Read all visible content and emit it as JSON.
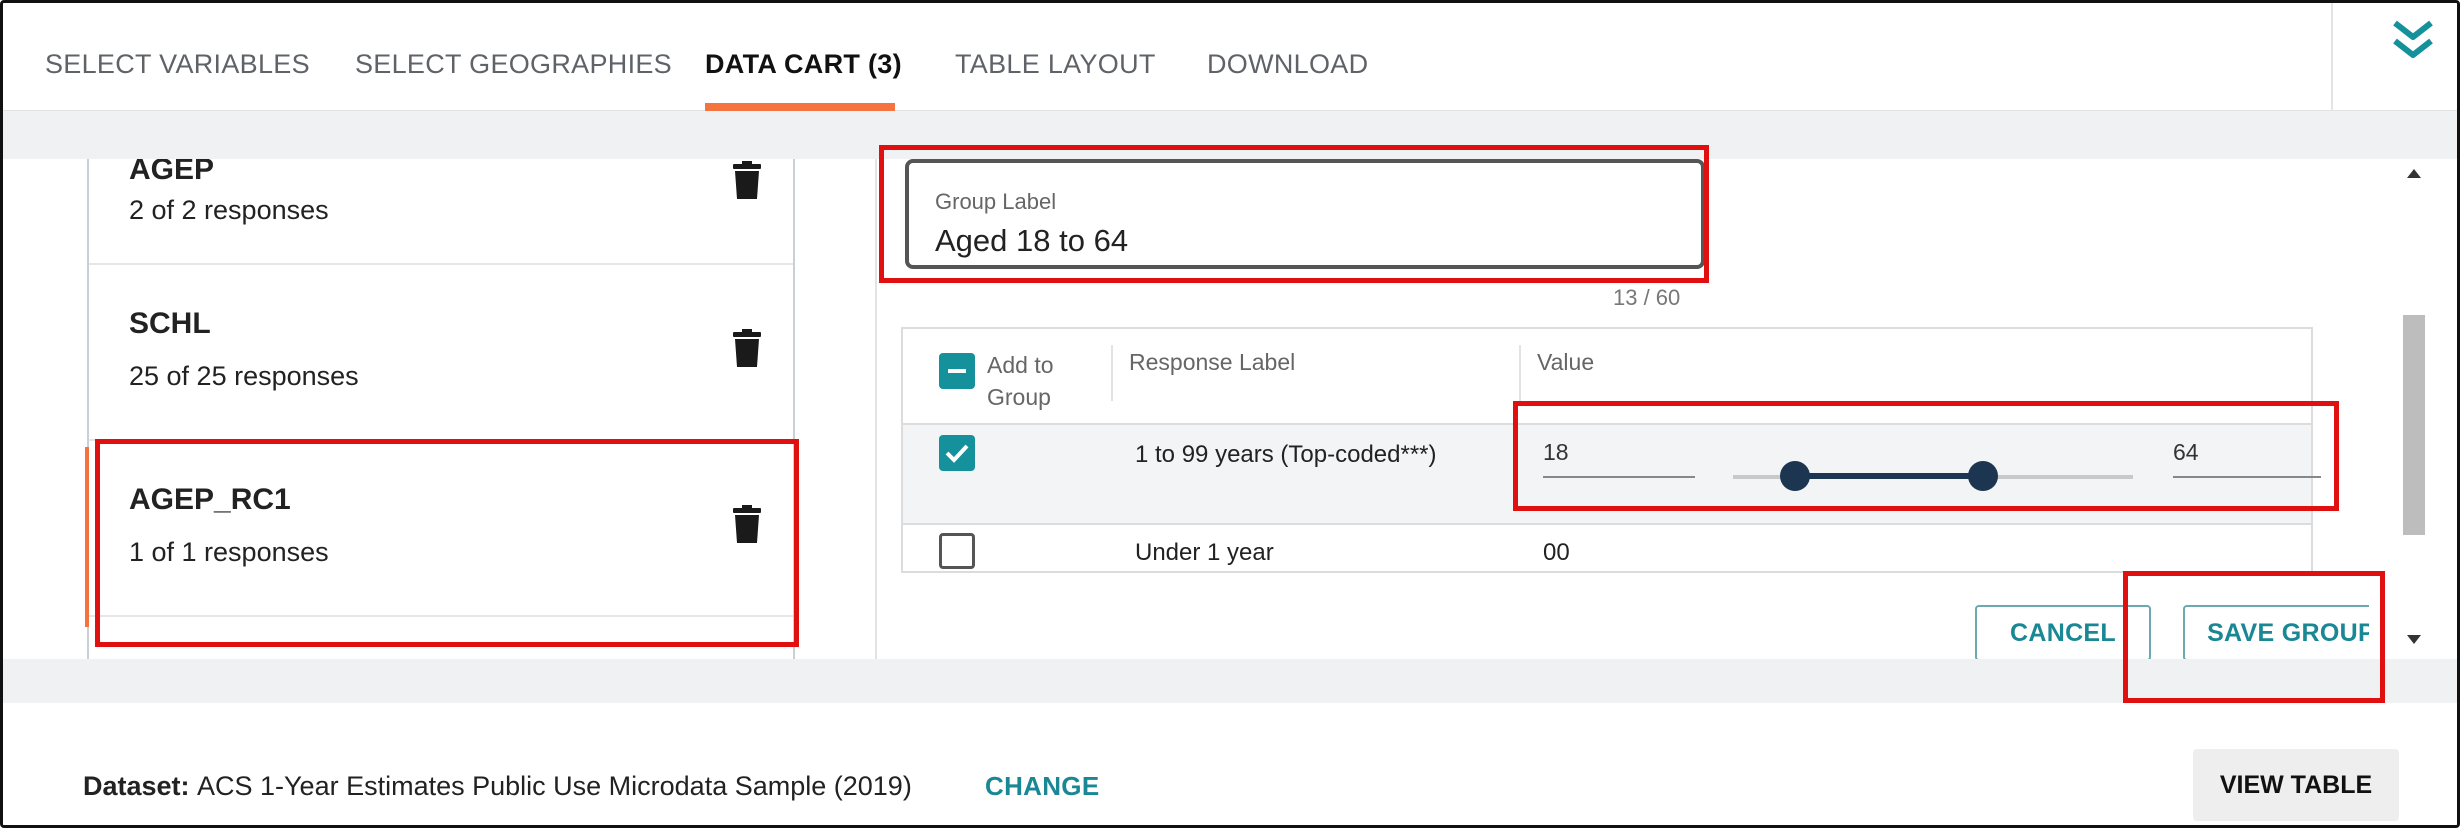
{
  "nav": {
    "tabs": [
      {
        "label": "SELECT VARIABLES"
      },
      {
        "label": "SELECT GEOGRAPHIES"
      },
      {
        "label": "DATA CART (3)"
      },
      {
        "label": "TABLE LAYOUT"
      },
      {
        "label": "DOWNLOAD"
      }
    ],
    "active_tab": "DATA CART (3)",
    "collapse_icon": "double-chevron-down-icon"
  },
  "cart": {
    "items": [
      {
        "name": "AGEP",
        "count": "2 of 2 responses"
      },
      {
        "name": "SCHL",
        "count": "25 of 25 responses"
      },
      {
        "name": "AGEP_RC1",
        "count": "1 of 1 responses"
      }
    ]
  },
  "group_editor": {
    "label_caption": "Group Label",
    "label_value": "Aged 18 to 64",
    "char_count": "13 / 60",
    "table": {
      "headers": {
        "add": "Add to Group",
        "response_label": "Response Label",
        "value": "Value"
      },
      "rows": [
        {
          "checked": true,
          "label": "1 to 99 years (Top-coded***)",
          "value_min": "18",
          "value_max": "64",
          "range_lower_fraction": 0.2,
          "range_upper_fraction": 0.65
        },
        {
          "checked": false,
          "label": "Under 1 year",
          "value": "00"
        }
      ]
    },
    "cancel_label": "CANCEL",
    "save_label": "SAVE GROUP"
  },
  "footer": {
    "dataset_label": "Dataset:",
    "dataset_value": "ACS 1-Year Estimates Public Use Microdata Sample (2019)",
    "change_label": "CHANGE",
    "view_table_label": "VIEW TABLE"
  },
  "colors": {
    "accent_teal": "#14919b",
    "tab_underline": "#f4733f",
    "annotation_red": "#e01010",
    "slider": "#1c3550"
  }
}
